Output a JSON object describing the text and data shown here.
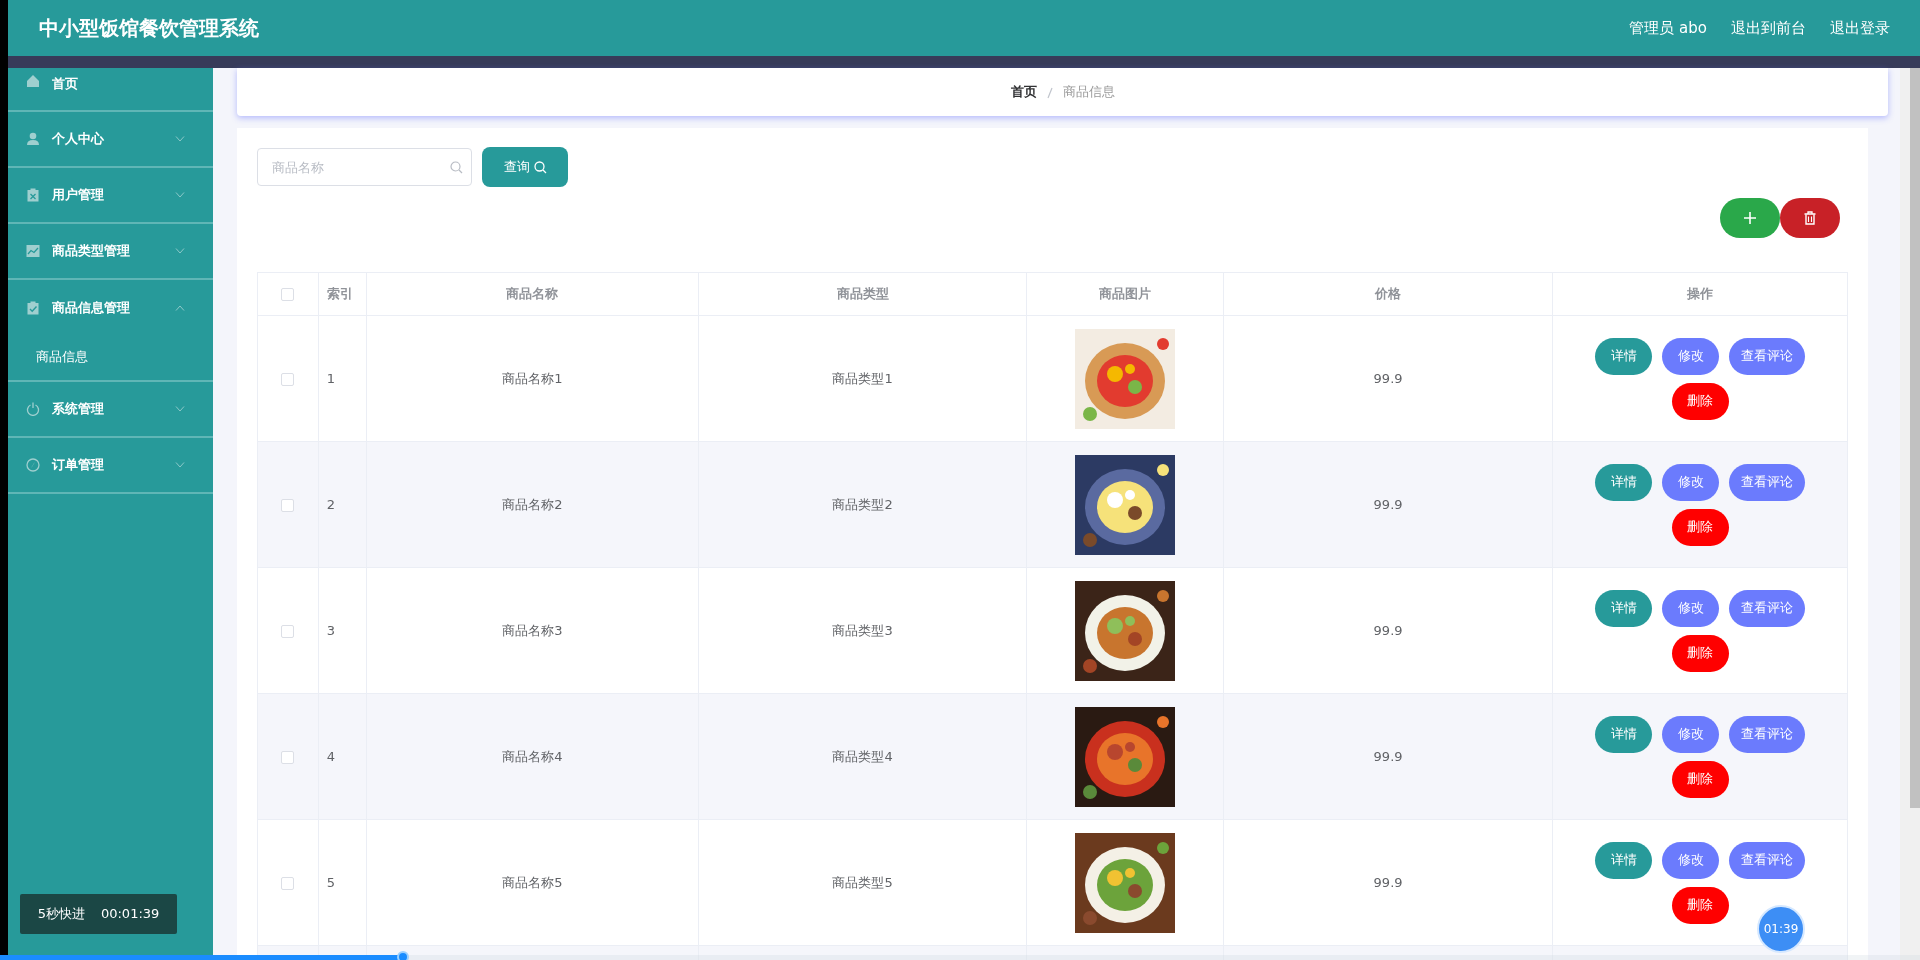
{
  "header": {
    "title": "中小型饭馆餐饮管理系统",
    "links": [
      "管理员 abo",
      "退出到前台",
      "退出登录"
    ]
  },
  "sidebar": {
    "items": [
      {
        "label": "首页",
        "kind": "link"
      },
      {
        "label": "个人中心",
        "kind": "menu",
        "expanded": false
      },
      {
        "label": "用户管理",
        "kind": "menu",
        "expanded": false
      },
      {
        "label": "商品类型管理",
        "kind": "menu",
        "expanded": false
      },
      {
        "label": "商品信息管理",
        "kind": "menu",
        "expanded": true,
        "children": [
          {
            "label": "商品信息"
          }
        ]
      },
      {
        "label": "系统管理",
        "kind": "menu",
        "expanded": false
      },
      {
        "label": "订单管理",
        "kind": "menu",
        "expanded": false
      }
    ]
  },
  "breadcrumb": [
    {
      "label": "首页",
      "current": false
    },
    {
      "label": "商品信息",
      "current": true
    }
  ],
  "search": {
    "placeholder": "商品名称",
    "button": "查询"
  },
  "table": {
    "columns": [
      "索引",
      "商品名称",
      "商品类型",
      "商品图片",
      "价格",
      "操作"
    ],
    "all_checked": false,
    "rows": [
      {
        "index": "1",
        "name": "商品名称1",
        "type": "商品类型1",
        "picture": {
          "kind": "picture"
        },
        "price": "99.9",
        "checked": false,
        "actions": [
          {
            "label": "详情",
            "kind": "detail"
          },
          {
            "label": "修改",
            "kind": "edit"
          },
          {
            "label": "查看评论",
            "kind": "edit"
          },
          {
            "label": "删除",
            "kind": "delete"
          }
        ]
      },
      {
        "index": "2",
        "name": "商品名称2",
        "type": "商品类型2",
        "picture": {
          "kind": "picture"
        },
        "price": "99.9",
        "checked": false,
        "actions": [
          {
            "label": "详情",
            "kind": "detail"
          },
          {
            "label": "修改",
            "kind": "edit"
          },
          {
            "label": "查看评论",
            "kind": "edit"
          },
          {
            "label": "删除",
            "kind": "delete"
          }
        ]
      },
      {
        "index": "3",
        "name": "商品名称3",
        "type": "商品类型3",
        "picture": {
          "kind": "picture"
        },
        "price": "99.9",
        "checked": false,
        "actions": [
          {
            "label": "详情",
            "kind": "detail"
          },
          {
            "label": "修改",
            "kind": "edit"
          },
          {
            "label": "查看评论",
            "kind": "edit"
          },
          {
            "label": "删除",
            "kind": "delete"
          }
        ]
      },
      {
        "index": "4",
        "name": "商品名称4",
        "type": "商品类型4",
        "picture": {
          "kind": "picture"
        },
        "price": "99.9",
        "checked": false,
        "actions": [
          {
            "label": "详情",
            "kind": "detail"
          },
          {
            "label": "修改",
            "kind": "edit"
          },
          {
            "label": "查看评论",
            "kind": "edit"
          },
          {
            "label": "删除",
            "kind": "delete"
          }
        ]
      },
      {
        "index": "5",
        "name": "商品名称5",
        "type": "商品类型5",
        "picture": {
          "kind": "picture"
        },
        "price": "99.9",
        "checked": false,
        "actions": [
          {
            "label": "详情",
            "kind": "detail"
          },
          {
            "label": "修改",
            "kind": "edit"
          },
          {
            "label": "查看评论",
            "kind": "edit"
          },
          {
            "label": "删除",
            "kind": "delete"
          }
        ]
      }
    ]
  },
  "player": {
    "skip_label": "5秒快进",
    "time": "00:01:39",
    "bubble_time": "01:39",
    "level": 0.21
  }
}
